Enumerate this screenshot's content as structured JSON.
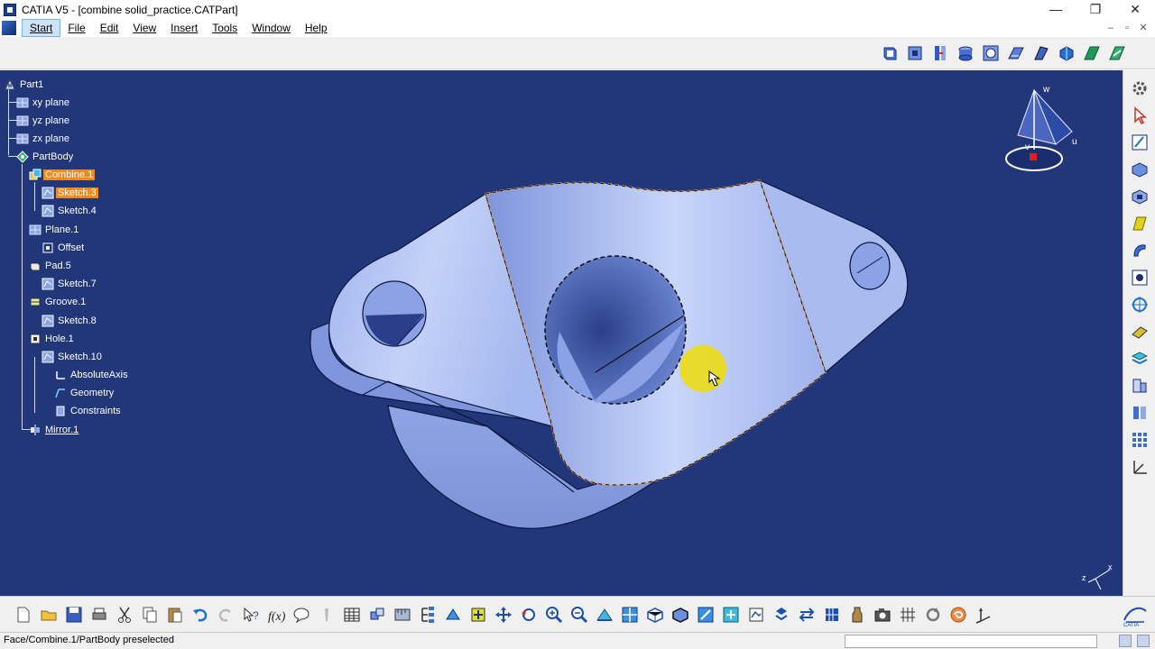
{
  "window": {
    "title": "CATIA V5 - [combine solid_practice.CATPart]",
    "controls": {
      "minimize": "—",
      "maximize": "❐",
      "close": "✕"
    }
  },
  "menubar": {
    "items": [
      {
        "label": "Start"
      },
      {
        "label": "File"
      },
      {
        "label": "Edit"
      },
      {
        "label": "View"
      },
      {
        "label": "Insert"
      },
      {
        "label": "Tools"
      },
      {
        "label": "Window"
      },
      {
        "label": "Help"
      }
    ],
    "mdi_controls": {
      "minimize": "–",
      "restore": "▫",
      "close": "✕"
    }
  },
  "colors": {
    "viewport_bg": "#22377a",
    "part_face": "#a8bbf0",
    "selection_highlight": "#f08a1c",
    "preselect_outline": "#e8a060",
    "cursor_highlight": "#ecdc14"
  },
  "spec_tree": {
    "nodes": [
      {
        "label": "Part1",
        "icon": "part-icon"
      },
      {
        "label": "xy plane",
        "icon": "plane-icon"
      },
      {
        "label": "yz plane",
        "icon": "plane-icon"
      },
      {
        "label": "zx plane",
        "icon": "plane-icon"
      },
      {
        "label": "PartBody",
        "icon": "partbody-icon"
      },
      {
        "label": "Combine.1",
        "icon": "combine-icon",
        "selected": true
      },
      {
        "label": "Sketch.3",
        "icon": "sketch-icon",
        "selected": true
      },
      {
        "label": "Sketch.4",
        "icon": "sketch-icon"
      },
      {
        "label": "Plane.1",
        "icon": "plane-icon"
      },
      {
        "label": "Offset",
        "icon": "parameter-icon"
      },
      {
        "label": "Pad.5",
        "icon": "pad-icon"
      },
      {
        "label": "Sketch.7",
        "icon": "sketch-icon"
      },
      {
        "label": "Groove.1",
        "icon": "groove-icon"
      },
      {
        "label": "Sketch.8",
        "icon": "sketch-icon"
      },
      {
        "label": "Hole.1",
        "icon": "hole-icon"
      },
      {
        "label": "Sketch.10",
        "icon": "sketch-icon"
      },
      {
        "label": "AbsoluteAxis",
        "icon": "axis-icon"
      },
      {
        "label": "Geometry",
        "icon": "geometry-icon"
      },
      {
        "label": "Constraints",
        "icon": "constraints-icon"
      },
      {
        "label": "Mirror.1",
        "icon": "mirror-icon",
        "underlined": true
      }
    ]
  },
  "compass": {
    "u": "u",
    "v": "v",
    "w": "w"
  },
  "mini_axis": {
    "x": "x",
    "z": "z"
  },
  "status": {
    "message": "Face/Combine.1/PartBody preselected",
    "command_input": ""
  }
}
